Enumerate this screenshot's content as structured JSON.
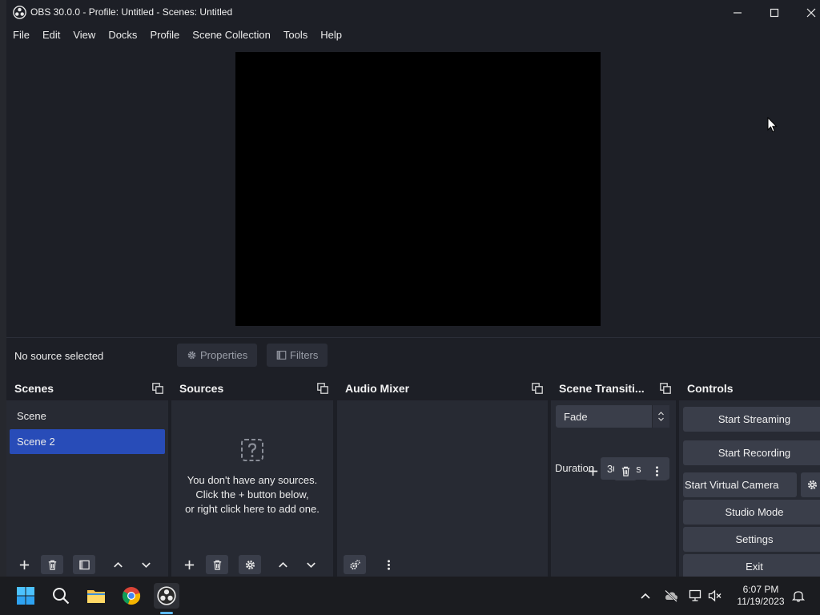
{
  "window": {
    "title": "OBS 30.0.0 - Profile: Untitled - Scenes: Untitled"
  },
  "menu": [
    "File",
    "Edit",
    "View",
    "Docks",
    "Profile",
    "Scene Collection",
    "Tools",
    "Help"
  ],
  "context_bar": {
    "status": "No source selected",
    "properties_label": "Properties",
    "filters_label": "Filters"
  },
  "docks": {
    "scenes": {
      "title": "Scenes",
      "items": [
        "Scene",
        "Scene 2"
      ],
      "selected_index": 1
    },
    "sources": {
      "title": "Sources",
      "empty_lines": [
        "You don't have any sources.",
        "Click the + button below,",
        "or right click here to add one."
      ]
    },
    "audio_mixer": {
      "title": "Audio Mixer"
    },
    "transitions": {
      "title": "Scene Transiti...",
      "selected": "Fade",
      "duration_label": "Duration",
      "duration_value": "300 ms"
    },
    "controls": {
      "title": "Controls",
      "buttons": [
        "Start Streaming",
        "Start Recording",
        "Start Virtual Camera",
        "Studio Mode",
        "Settings",
        "Exit"
      ]
    }
  },
  "taskbar": {
    "time": "6:07 PM",
    "date": "11/19/2023",
    "active_app": "obs"
  },
  "colors": {
    "window_bg": "#1d1f26",
    "dock_bg": "#272a33",
    "button_bg": "#3a3e4a",
    "selection": "#284cb8",
    "taskbar_bg": "#1b1c20"
  }
}
